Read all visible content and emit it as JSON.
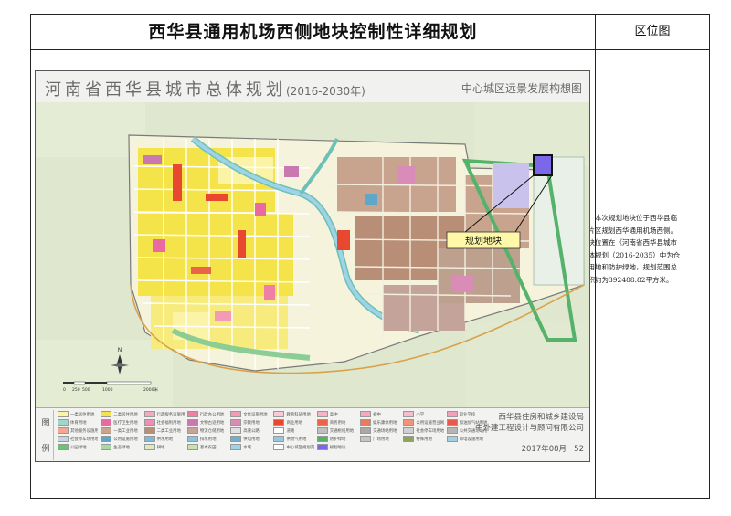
{
  "title": "西华县通用机场西侧地块控制性详细规划",
  "location_label": "区位图",
  "description": "本次规划地块位于西华县临空片区规划西华通用机场西侧。地块位置在《河南省西华县城市总体规划（2016-2035）中为仓储用地和防护绿地，规划范围总面积约为392488.82平方米。",
  "map": {
    "title": "河南省西华县城市总体规划",
    "title_years": "(2016-2030年)",
    "subtitle": "中心城区远景发展构想图",
    "site_label": "规划地块",
    "scale_labels": [
      "0",
      "250",
      "500",
      "1000",
      "2000米"
    ],
    "north_label": "N"
  },
  "legend": {
    "title_chars": [
      "图",
      "例"
    ],
    "organizations": [
      "西华县住房和城乡建设局",
      "中外建工程设计与顾问有限公司"
    ],
    "date": "2017年08月",
    "page": "52",
    "items": [
      {
        "label": "一类居住用地",
        "color": "#fbf3a6"
      },
      {
        "label": "二类居住用地",
        "color": "#f4e44a"
      },
      {
        "label": "行政服务设施用地",
        "color": "#f6a7c1"
      },
      {
        "label": "行政办公用地",
        "color": "#ef7fa6"
      },
      {
        "label": "文化设施用地",
        "color": "#f39bb4"
      },
      {
        "label": "教育科研用地",
        "color": "#f8c9d6"
      },
      {
        "label": "高中",
        "color": "#f6b3c6"
      },
      {
        "label": "初中",
        "color": "#f5a8bf"
      },
      {
        "label": "小学",
        "color": "#f7bccd"
      },
      {
        "label": "职业学校",
        "color": "#f4a0b9"
      },
      {
        "label": "体育用地",
        "color": "#9fd8c8"
      },
      {
        "label": "医疗卫生用地",
        "color": "#e86aa1"
      },
      {
        "label": "社会福利用地",
        "color": "#f08fb2"
      },
      {
        "label": "文物古迹用地",
        "color": "#c979b0"
      },
      {
        "label": "宗教用地",
        "color": "#d98cb8"
      },
      {
        "label": "商业用地",
        "color": "#e7482f"
      },
      {
        "label": "商务用地",
        "color": "#ea6447"
      },
      {
        "label": "娱乐康体用地",
        "color": "#ec7a5e"
      },
      {
        "label": "公用设施营业网点用地",
        "color": "#f0937a"
      },
      {
        "label": "加油加气站用地",
        "color": "#e9594c"
      },
      {
        "label": "其他服务设施用地",
        "color": "#f3a793"
      },
      {
        "label": "一类工业用地",
        "color": "#c8a48e"
      },
      {
        "label": "二类工业用地",
        "color": "#b88f76"
      },
      {
        "label": "物流仓储用地",
        "color": "#c4a49a"
      },
      {
        "label": "高速公路",
        "color": "#e0e0e0"
      },
      {
        "label": "道路",
        "color": "#ffffff"
      },
      {
        "label": "交通枢纽用地",
        "color": "#bfbfbf"
      },
      {
        "label": "交通场站用地",
        "color": "#a8a8a8"
      },
      {
        "label": "社会停车场用地",
        "color": "#d0d0d0"
      },
      {
        "label": "公共交通场站用地",
        "color": "#b4b4b4"
      },
      {
        "label": "社会停车场用地",
        "color": "#c2d6e2"
      },
      {
        "label": "公用设施用地",
        "color": "#5fa7c9"
      },
      {
        "label": "供水用地",
        "color": "#7fb9d6"
      },
      {
        "label": "排水用地",
        "color": "#8cc3db"
      },
      {
        "label": "供电用地",
        "color": "#6fb0cf"
      },
      {
        "label": "供燃气用地",
        "color": "#97c9de"
      },
      {
        "label": "防护绿地",
        "color": "#55b26a"
      },
      {
        "label": "广场用地",
        "color": "#c4c4c4"
      },
      {
        "label": "特殊用地",
        "color": "#8fa35b"
      },
      {
        "label": "邮电设施用地",
        "color": "#a2d0e1"
      },
      {
        "label": "公园绿地",
        "color": "#69c36f"
      },
      {
        "label": "生态绿地",
        "color": "#a7d9a0"
      },
      {
        "label": "耕地",
        "color": "#d9ecc0"
      },
      {
        "label": "基本农田",
        "color": "#c7e3a8"
      },
      {
        "label": "水域",
        "color": "#9fd3e8"
      },
      {
        "label": "中心城区规划范围",
        "color": "#ffffff"
      },
      {
        "label": "规划地块",
        "color": "#7b68e8"
      }
    ]
  }
}
